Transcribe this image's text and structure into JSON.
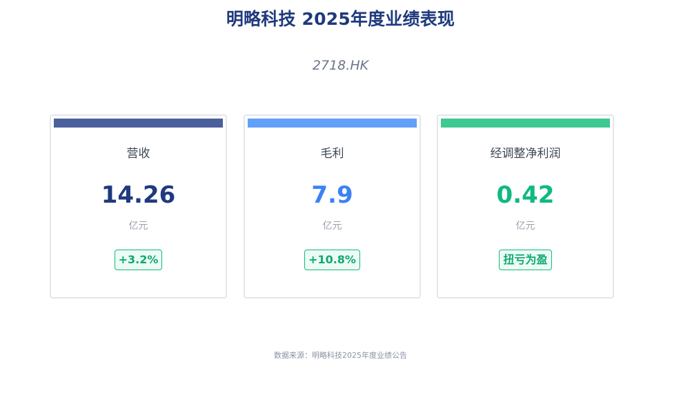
{
  "header": {
    "title": "明略科技 2025年度业绩表现",
    "ticker": "2718.HK"
  },
  "cards": [
    {
      "label": "营收",
      "value": "14.26",
      "unit": "亿元",
      "change": "+3.2%",
      "accent_color": "#4a5f9c",
      "value_color": "#1f3a7d"
    },
    {
      "label": "毛利",
      "value": "7.9",
      "unit": "亿元",
      "change": "+10.8%",
      "accent_color": "#60a0f8",
      "value_color": "#3b82f6"
    },
    {
      "label": "经调整净利润",
      "value": "0.42",
      "unit": "亿元",
      "change": "扭亏为盈",
      "accent_color": "#3ec892",
      "value_color": "#10b981"
    }
  ],
  "footer": {
    "source": "数据来源：明略科技2025年度业绩公告"
  },
  "colors": {
    "title": "#1f3a7d",
    "badge_border": "#10b981",
    "badge_bg": "#ecfbf4",
    "badge_text": "#10a874"
  }
}
